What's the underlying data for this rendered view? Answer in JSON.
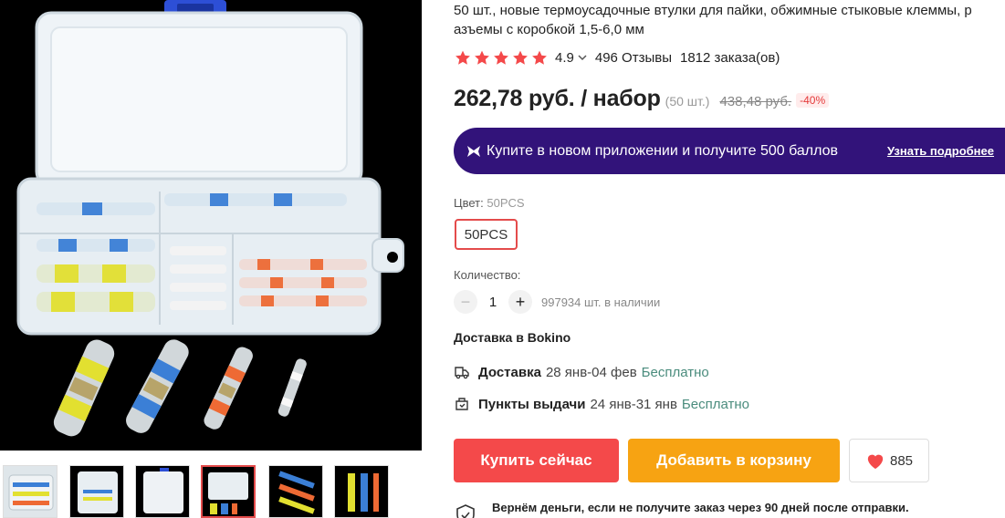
{
  "product": {
    "title": "50 шт., новые термоусадочные втулки для пайки, обжимные стыковые клеммы, р\nазъемы с коробкой 1,5-6,0 мм",
    "rating_value": "4.9",
    "reviews": "496 Отзывы",
    "orders": "1812 заказа(ов)",
    "price": "262,78 руб. / набор",
    "per_unit": "(50 шт.)",
    "old_price": "438,48 руб.",
    "discount": "-40%"
  },
  "app_banner": {
    "text": "Купите в новом приложении и получите 500 баллов",
    "link": "Узнать подробнее"
  },
  "color": {
    "label": "Цвет: ",
    "selected": "50PCS",
    "options": [
      "50PCS"
    ]
  },
  "quantity": {
    "label": "Количество:",
    "minus": "−",
    "value": "1",
    "plus": "+",
    "stock": "997934 шт. в наличии"
  },
  "delivery": {
    "title": "Доставка в Bokino",
    "rows": [
      {
        "name": "Доставка",
        "dates": "28 янв-04 фев",
        "price": "Бесплатно"
      },
      {
        "name": "Пункты выдачи",
        "dates": "24 янв-31 янв",
        "price": "Бесплатно"
      }
    ]
  },
  "actions": {
    "buy_now": "Купить сейчас",
    "add_to_cart": "Добавить в корзину",
    "wishlist_count": "885"
  },
  "guarantee": {
    "text": "Вернём деньги, если не получите заказ через 90 дней после отправки."
  },
  "colors": {
    "accent_red": "#f4494a",
    "cart_orange": "#f7a312",
    "banner_purple": "#32137a",
    "star": "#f4494a",
    "free_green": "#4a8c7d"
  },
  "icons": {
    "main_photo": "product-photo-box-of-connectors",
    "app_icon": "aliexpress-bowtie-icon",
    "delivery_icon": "truck-icon",
    "pickup_icon": "pickup-point-icon",
    "wishlist_icon": "heart-icon",
    "guarantee_icon": "shield-check-icon"
  }
}
